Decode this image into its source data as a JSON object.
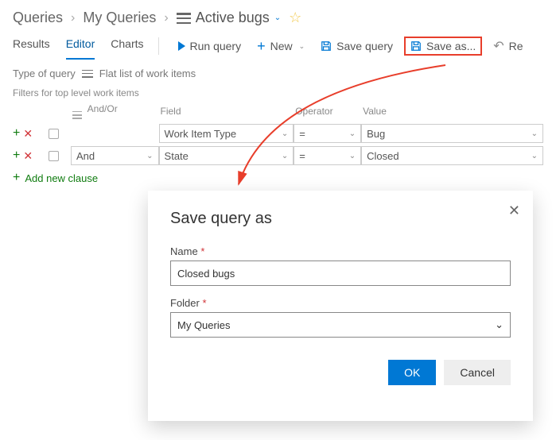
{
  "breadcrumb": {
    "root": "Queries",
    "mid": "My Queries",
    "current": "Active bugs"
  },
  "tabs": {
    "results": "Results",
    "editor": "Editor",
    "charts": "Charts"
  },
  "toolbar": {
    "run": "Run query",
    "new": "New",
    "save": "Save query",
    "saveas": "Save as...",
    "undo_partial": "Re"
  },
  "qtype": {
    "label": "Type of query",
    "value": "Flat list of work items"
  },
  "filters": {
    "heading": "Filters for top level work items",
    "cols": {
      "andor": "And/Or",
      "field": "Field",
      "op": "Operator",
      "val": "Value"
    },
    "rows": [
      {
        "andor": "",
        "field": "Work Item Type",
        "op": "=",
        "val": "Bug"
      },
      {
        "andor": "And",
        "field": "State",
        "op": "=",
        "val": "Closed"
      }
    ],
    "add": "Add new clause"
  },
  "dialog": {
    "title": "Save query as",
    "name_label": "Name",
    "name_value": "Closed bugs",
    "folder_label": "Folder",
    "folder_value": "My Queries",
    "ok": "OK",
    "cancel": "Cancel"
  }
}
